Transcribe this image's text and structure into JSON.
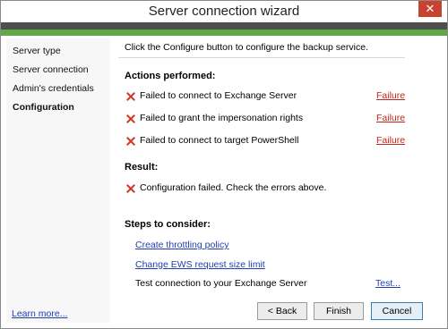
{
  "window": {
    "title": "Server connection wizard",
    "close_glyph": "✕"
  },
  "sidebar": {
    "items": [
      {
        "label": "Server type",
        "active": false
      },
      {
        "label": "Server connection",
        "active": false
      },
      {
        "label": "Admin's credentials",
        "active": false
      },
      {
        "label": "Configuration",
        "active": true
      }
    ],
    "learn_more": "Learn more..."
  },
  "main": {
    "intro": "Click the Configure button to configure the backup service.",
    "actions_heading": "Actions performed:",
    "actions": [
      {
        "text": "Failed to connect to Exchange Server",
        "status": "Failure"
      },
      {
        "text": "Failed to grant the impersonation rights",
        "status": "Failure"
      },
      {
        "text": "Failed to connect to target PowerShell",
        "status": "Failure"
      }
    ],
    "result_heading": "Result:",
    "result_text": "Configuration failed. Check the errors above.",
    "steps_heading": "Steps to consider:",
    "steps": {
      "throttling": "Create throttling policy",
      "ews": "Change EWS request size limit",
      "test_label": "Test connection to your Exchange Server",
      "test_link": "Test..."
    }
  },
  "buttons": {
    "back": "< Back",
    "finish": "Finish",
    "cancel": "Cancel"
  },
  "colors": {
    "accent_bar": "#4e4e4e",
    "progress_green": "#5fa845",
    "close": "#c7432f",
    "error": "#d03a2a",
    "link": "#1f3fb5"
  },
  "icons": {
    "close": "close-icon",
    "error": "error-x-icon"
  }
}
